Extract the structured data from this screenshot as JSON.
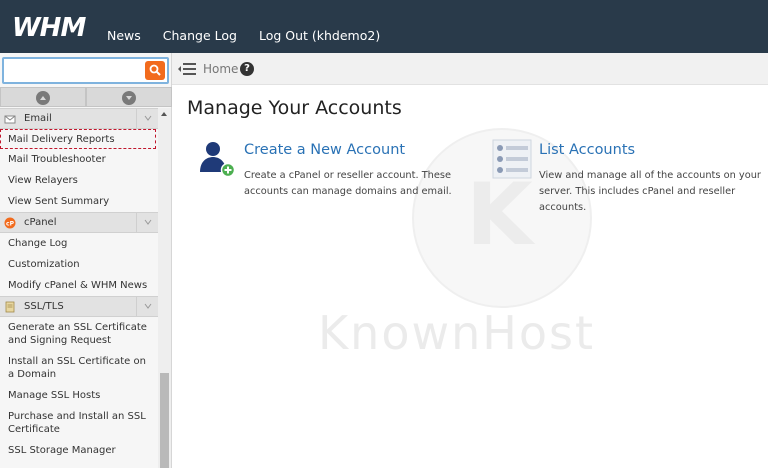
{
  "header": {
    "logo": "WHM",
    "nav": [
      {
        "label": "News"
      },
      {
        "label": "Change Log"
      },
      {
        "label": "Log Out (khdemo2)"
      }
    ]
  },
  "sidebar": {
    "search": {
      "value": "",
      "placeholder": ""
    },
    "groups": [
      {
        "label": "Email",
        "icon": "email-icon",
        "items": [
          "Mail Delivery Reports",
          "Mail Troubleshooter",
          "View Relayers",
          "View Sent Summary"
        ]
      },
      {
        "label": "cPanel",
        "icon": "cpanel-icon",
        "items": [
          "Change Log",
          "Customization",
          "Modify cPanel & WHM News"
        ]
      },
      {
        "label": "SSL/TLS",
        "icon": "ssl-icon",
        "items": [
          "Generate an SSL Certificate and Signing Request",
          "Install an SSL Certificate on a Domain",
          "Manage SSL Hosts",
          "Purchase and Install an SSL Certificate",
          "SSL Storage Manager"
        ]
      }
    ],
    "selected_item": "Mail Delivery Reports"
  },
  "breadcrumb": {
    "home": "Home",
    "help": "?"
  },
  "main": {
    "title": "Manage Your Accounts",
    "cards": [
      {
        "title": "Create a New Account",
        "desc": "Create a cPanel or reseller account. These accounts can manage domains and email.",
        "icon": "add-user-icon"
      },
      {
        "title": "List Accounts",
        "desc": "View and manage all of the accounts on your server. This includes cPanel and reseller accounts.",
        "icon": "list-accounts-icon"
      }
    ]
  },
  "watermark": {
    "mark": "K",
    "text": "KnownHost"
  },
  "colors": {
    "header_bg": "#293a4a",
    "accent_orange": "#f26b1d",
    "link_blue": "#2a72b5",
    "selected_border": "#c0162c"
  }
}
